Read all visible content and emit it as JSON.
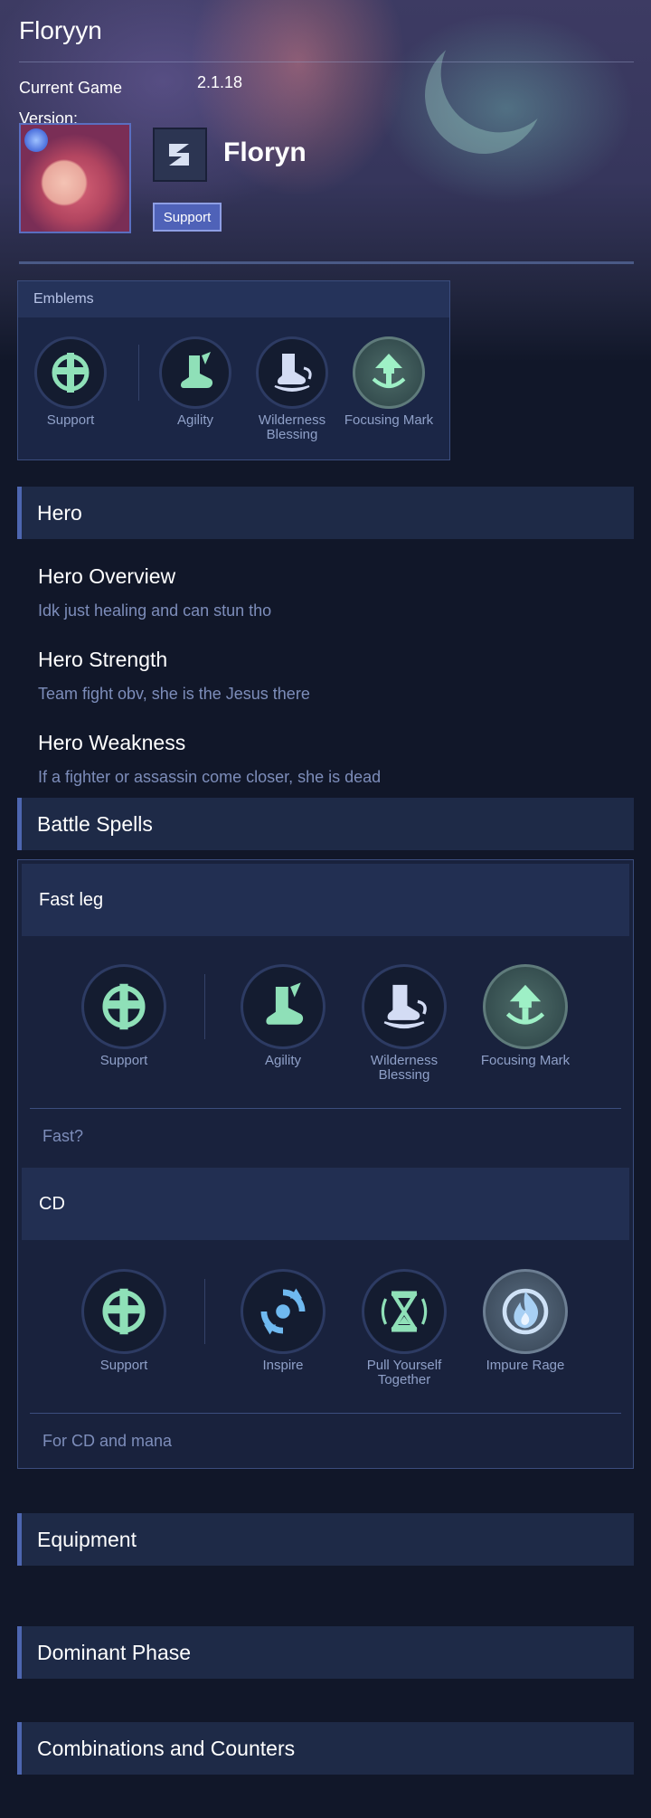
{
  "page_title": "Floryyn",
  "version": {
    "label": "Current Game Version:",
    "value": "2.1.18"
  },
  "hero": {
    "name": "Floryn",
    "role_badge": "Support"
  },
  "emblems": {
    "title": "Emblems",
    "items": [
      "Support",
      "Agility",
      "Wilderness Blessing",
      "Focusing Mark"
    ]
  },
  "sections": {
    "hero": "Hero",
    "battle_spells": "Battle Spells",
    "equipment": "Equipment",
    "dominant_phase": "Dominant Phase",
    "combinations": "Combinations and Counters"
  },
  "hero_info": {
    "overview_title": "Hero Overview",
    "overview_text": "Idk just healing and can stun tho",
    "strength_title": "Hero Strength",
    "strength_text": "Team fight obv, she is the Jesus there",
    "weakness_title": "Hero Weakness",
    "weakness_text": "If a fighter or assassin come closer, she is dead"
  },
  "builds": [
    {
      "name": "Fast leg",
      "items": [
        "Support",
        "Agility",
        "Wilderness Blessing",
        "Focusing Mark"
      ],
      "note": "Fast?"
    },
    {
      "name": "CD",
      "items": [
        "Support",
        "Inspire",
        "Pull Yourself Together",
        "Impure Rage"
      ],
      "note": "For CD and mana"
    }
  ],
  "colors": {
    "background": "#111729",
    "card": "#1b2646",
    "accent": "#4d66b0",
    "icon_green": "#8fe0b8",
    "muted_text": "#7d8dba"
  }
}
